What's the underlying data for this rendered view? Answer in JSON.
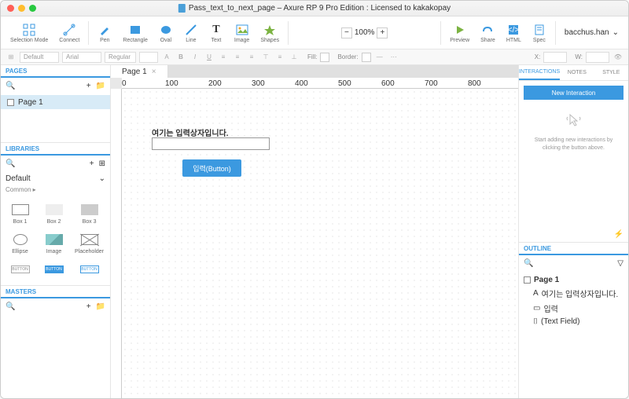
{
  "window": {
    "title": "Pass_text_to_next_page – Axure RP 9 Pro Edition : Licensed to kakakopay"
  },
  "user": {
    "name": "bacchus.han"
  },
  "toolbar": {
    "selection_mode": "Selection Mode",
    "connect": "Connect",
    "pen": "Pen",
    "rectangle": "Rectangle",
    "oval": "Oval",
    "line": "Line",
    "text": "Text",
    "image": "Image",
    "shapes": "Shapes",
    "preview": "Preview",
    "share": "Share",
    "html": "HTML",
    "spec": "Spec"
  },
  "zoom": {
    "value": "100%"
  },
  "format": {
    "style_sel": "Default",
    "font_sel": "Arial",
    "weight_sel": "Regular",
    "fill_label": "Fill:",
    "border_label": "Border:",
    "x_label": "X:",
    "w_label": "W:"
  },
  "left": {
    "pages_header": "PAGES",
    "page1": "Page 1",
    "libraries_header": "LIBRARIES",
    "lib_name": "Default",
    "lib_sub": "Common ▸",
    "widgets": {
      "box1": "Box 1",
      "box2": "Box 2",
      "box3": "Box 3",
      "ellipse": "Ellipse",
      "image": "Image",
      "placeholder": "Placeholder",
      "button1": "BUTTON",
      "button2": "BUTTON",
      "button3": "BUTTON"
    },
    "masters_header": "MASTERS"
  },
  "canvas": {
    "tab_name": "Page 1",
    "ruler_marks": [
      "0",
      "100",
      "200",
      "300",
      "400",
      "500",
      "600",
      "700",
      "800"
    ],
    "label_text": "여기는 입력상자입니다.",
    "button_text": "입력(Button)"
  },
  "right": {
    "tabs": {
      "interactions": "INTERACTIONS",
      "notes": "NOTES",
      "style": "STYLE"
    },
    "new_interaction": "New Interaction",
    "placeholder_text": "Start adding new interactions by clicking the button above.",
    "outline_header": "OUTLINE",
    "outline": {
      "root": "Page 1",
      "item1": "여기는 입력상자입니다.",
      "item2": "입력",
      "item3": "(Text Field)"
    }
  }
}
